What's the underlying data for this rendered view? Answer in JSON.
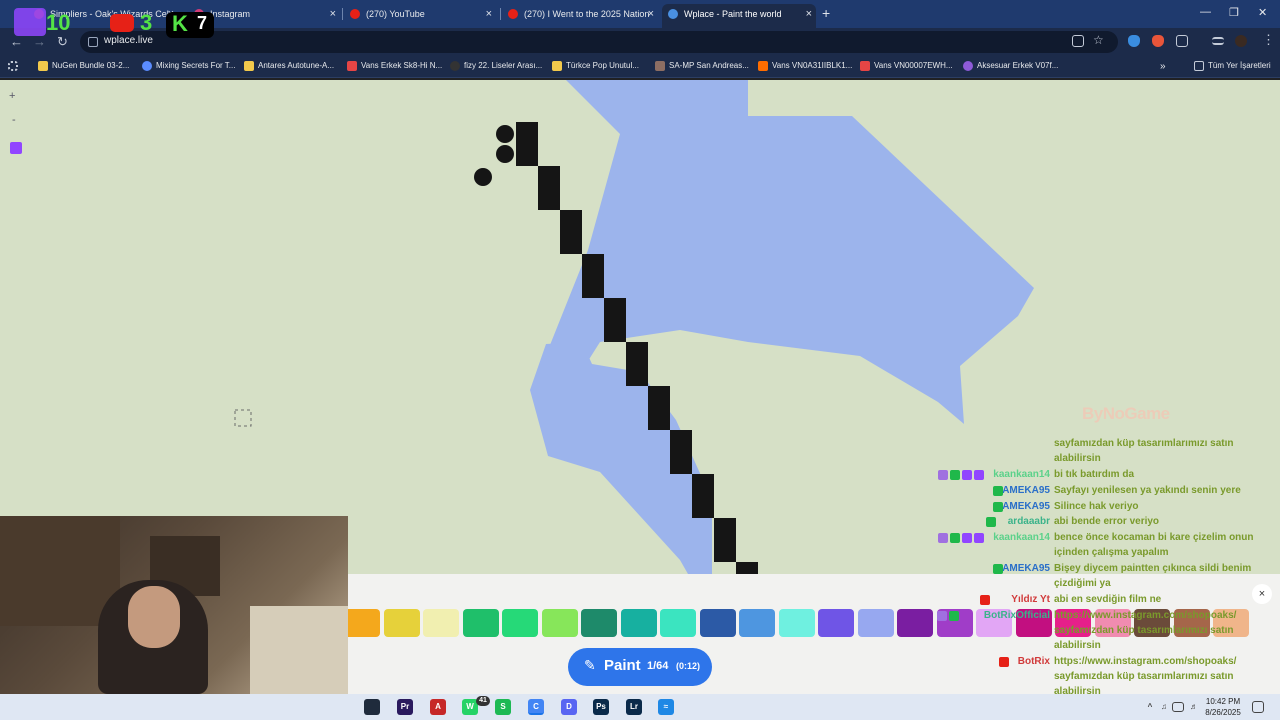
{
  "browser": {
    "tabs": [
      {
        "label": "Simpliers - Oak's Wizards Cek",
        "fav": "#e24a3b",
        "close": "×"
      },
      {
        "label": "Instagram",
        "fav": "#d23b77",
        "close": "×"
      },
      {
        "label": "(270) YouTube",
        "fav": "#e62117",
        "close": "×"
      },
      {
        "label": "(270) I Went to the 2025 Nation",
        "fav": "#e62117",
        "close": "×"
      },
      {
        "label": "Wplace - Paint the world",
        "fav": "#4a90e2",
        "close": "×"
      }
    ],
    "new_tab": "+",
    "url": "wplace.live",
    "bookmarks": [
      {
        "label": "NuGen Bundle 03-2...",
        "color": "#f2c94c"
      },
      {
        "label": "Mixing Secrets For T...",
        "color": "#5b8cff"
      },
      {
        "label": "Antares Autotune-A...",
        "color": "#f2c94c"
      },
      {
        "label": "Vans Erkek Sk8-Hi N...",
        "color": "#e64545"
      },
      {
        "label": "fizy 22. Liseler Arası...",
        "color": "#333333"
      },
      {
        "label": "Türkce Pop Unutul...",
        "color": "#f2c94c"
      },
      {
        "label": "SA-MP San Andreas...",
        "color": "#8d6e63"
      },
      {
        "label": "Vans VN0A31IIBLK1...",
        "color": "#ff6d00"
      },
      {
        "label": "Vans VN00007EWH...",
        "color": "#e64545"
      },
      {
        "label": "Aksesuar Erkek V07f...",
        "color": "#8e5bd8"
      }
    ],
    "all_bookmarks": "Tüm Yer İşaretleri"
  },
  "map": {
    "zoom_in": "+",
    "zoom_out": "-",
    "brand_watermark": "ByNoGame"
  },
  "palette": {
    "colors": [
      "#f4a81c",
      "#e6d13a",
      "#f1efb0",
      "#1fbf6a",
      "#26d978",
      "#87e65a",
      "#1e8a6a",
      "#17b0a0",
      "#3be4c0",
      "#2c5aa6",
      "#4e96e0",
      "#6ff0e0",
      "#6f55e6",
      "#97a8f0",
      "#7a1ea1",
      "#a03dc8",
      "#e2a6f5",
      "#c20f80",
      "#e6208a",
      "#f08cb0",
      "#6b4b3a",
      "#a5664a",
      "#f0b58a",
      "#cfcfcf"
    ],
    "paint_label": "Paint",
    "paint_count": "1/64",
    "paint_timer": "(0:12)",
    "close": "×"
  },
  "overlay": {
    "twitch_count": "10",
    "youtube_count": "3",
    "kick_count": "7"
  },
  "chat": [
    {
      "user": "",
      "msg": "sayfamızdan küp tasarımlarımızı satın alabilirsin",
      "ucolor": "#7a9a2c",
      "badges": []
    },
    {
      "user": "kaankaan14",
      "msg": "bi tık batırdım da",
      "ucolor": "#5bd18a",
      "badges": [
        "#a070e0",
        "#1fb84a",
        "#9146ff",
        "#9146ff"
      ]
    },
    {
      "user": "AMEKA95",
      "msg": "Sayfayı yenilesen ya yakındı senin yere",
      "ucolor": "#2a6fc9",
      "badges": [
        "#1fb84a"
      ]
    },
    {
      "user": "AMEKA95",
      "msg": "Silince hak veriyo",
      "ucolor": "#2a6fc9",
      "badges": [
        "#1fb84a"
      ]
    },
    {
      "user": "ardaaabr",
      "msg": "abi bende error veriyo",
      "ucolor": "#3bb38a",
      "badges": [
        "#1fb84a"
      ]
    },
    {
      "user": "kaankaan14",
      "msg": "bence önce kocaman bi kare çizelim onun içinden çalışma yapalım",
      "ucolor": "#5bd18a",
      "badges": [
        "#a070e0",
        "#1fb84a",
        "#9146ff",
        "#9146ff"
      ]
    },
    {
      "user": "AMEKA95",
      "msg": "Bişey diycem paintten çıkınca sildi benim çizdiğimi ya",
      "ucolor": "#2a6fc9",
      "badges": [
        "#1fb84a"
      ]
    },
    {
      "user": "Yıldız Yt",
      "msg": "abi en sevdiğin film ne",
      "ucolor": "#d13b3b",
      "badges": [
        "#e62117"
      ]
    },
    {
      "user": "BotRixOfficial",
      "msg": "https://www.instagram.com/shopoaks/ sayfamızdan küp tasarımlarımızı satın alabilirsin",
      "ucolor": "#3bb38a",
      "badges": [
        "#a070e0",
        "#1fb84a"
      ]
    },
    {
      "user": "BotRix",
      "msg": "https://www.instagram.com/shopoaks/ sayfamızdan küp tasarımlarımızı satın alabilirsin",
      "ucolor": "#d13b3b",
      "badges": [
        "#e62117"
      ]
    }
  ],
  "taskbar": {
    "apps": [
      {
        "name": "Pr",
        "color": "#2a1a5e"
      },
      {
        "name": "A",
        "color": "#c62828"
      },
      {
        "name": "W",
        "color": "#25d366"
      },
      {
        "name": "S",
        "color": "#1db954"
      },
      {
        "name": "C",
        "color": "#4285f4"
      },
      {
        "name": "D",
        "color": "#5865f2"
      },
      {
        "name": "Ps",
        "color": "#0a2a4a"
      },
      {
        "name": "Lr",
        "color": "#0a2a4a"
      },
      {
        "name": "≈",
        "color": "#1e88e5"
      }
    ],
    "whatsapp_badge": "41",
    "time": "10:42 PM",
    "date": "8/26/2025"
  }
}
